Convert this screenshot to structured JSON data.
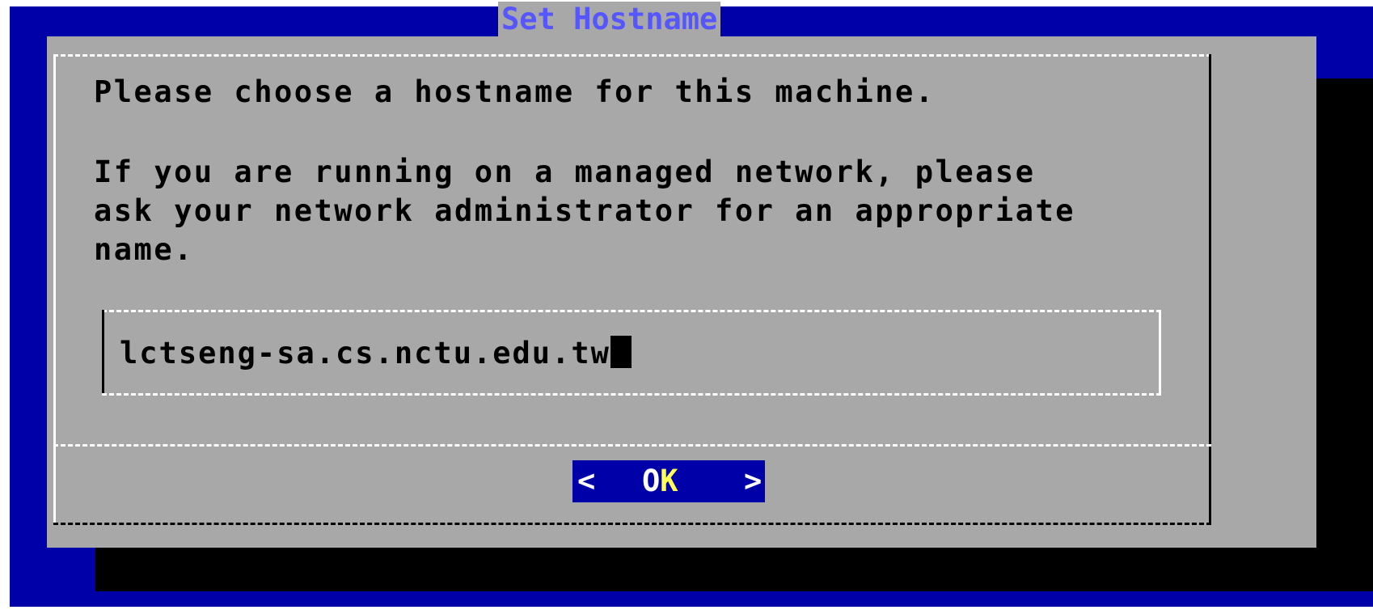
{
  "dialog": {
    "title": "Set Hostname",
    "message_line_1": "Please choose a hostname for this machine.",
    "message_line_2": "If you are running on a managed network, please",
    "message_line_3": "ask your network administrator for an appropriate",
    "message_line_4": "name."
  },
  "hostname_input": {
    "value": "lctseng-sa.cs.nctu.edu.tw"
  },
  "ok_button": {
    "left_bracket": "<",
    "label_first": "O",
    "label_hotkey": "K",
    "right_bracket": ">"
  },
  "colors": {
    "screen_background": "#0000a8",
    "dialog_background": "#a8a8a8",
    "title_text": "#5656ff",
    "button_background": "#0000a8",
    "button_text": "#ffffff",
    "button_hotkey": "#ffff54",
    "shadow": "#000000"
  }
}
